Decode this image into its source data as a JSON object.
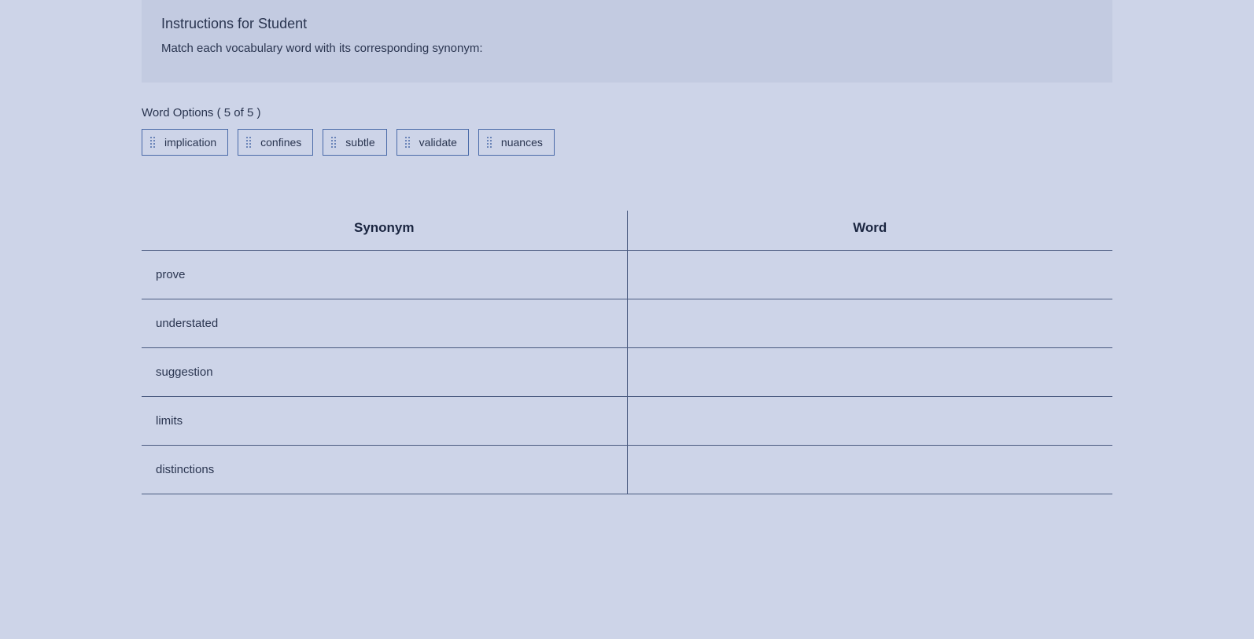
{
  "instructions": {
    "title": "Instructions for Student",
    "text": "Match each vocabulary word with its corresponding synonym:"
  },
  "wordOptions": {
    "label": "Word Options ( 5 of 5 )",
    "items": [
      "implication",
      "confines",
      "subtle",
      "validate",
      "nuances"
    ]
  },
  "table": {
    "headers": {
      "synonym": "Synonym",
      "word": "Word"
    },
    "rows": [
      {
        "synonym": "prove",
        "word": ""
      },
      {
        "synonym": "understated",
        "word": ""
      },
      {
        "synonym": "suggestion",
        "word": ""
      },
      {
        "synonym": "limits",
        "word": ""
      },
      {
        "synonym": "distinctions",
        "word": ""
      }
    ]
  }
}
